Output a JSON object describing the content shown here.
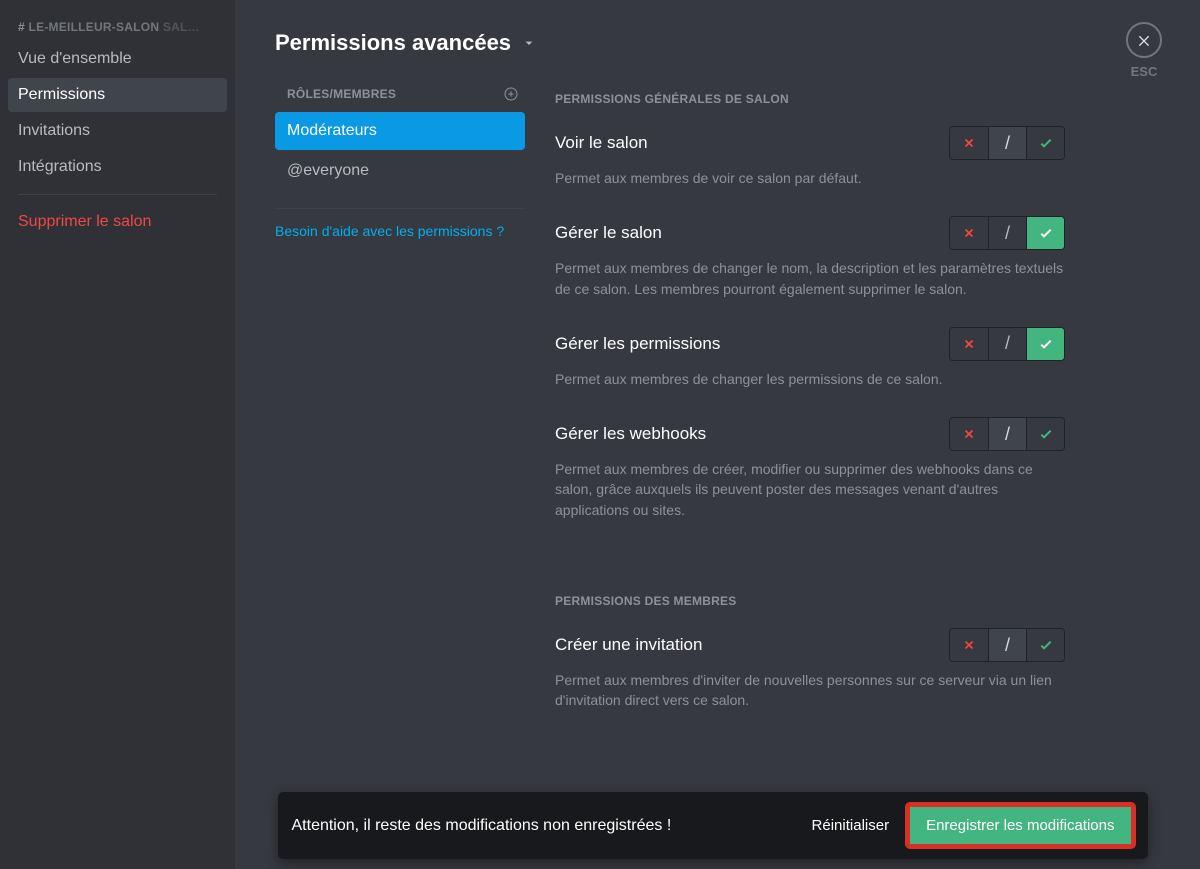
{
  "sidebar": {
    "header_prefix": "# ",
    "header_name": "LE-MEILLEUR-SALON",
    "header_trunc": " SAL…",
    "items": [
      {
        "label": "Vue d'ensemble",
        "active": false
      },
      {
        "label": "Permissions",
        "active": true
      },
      {
        "label": "Invitations",
        "active": false
      },
      {
        "label": "Intégrations",
        "active": false
      }
    ],
    "delete_label": "Supprimer le salon"
  },
  "header": {
    "title": "Permissions avancées",
    "esc": "ESC"
  },
  "roles": {
    "header": "RÔLES/MEMBRES",
    "items": [
      {
        "label": "Modérateurs",
        "active": true
      },
      {
        "label": "@everyone",
        "active": false
      }
    ],
    "help": "Besoin d'aide avec les permissions ?"
  },
  "sections": [
    {
      "header": "PERMISSIONS GÉNÉRALES DE SALON",
      "perms": [
        {
          "title": "Voir le salon",
          "desc": "Permet aux membres de voir ce salon par défaut.",
          "state": "pass"
        },
        {
          "title": "Gérer le salon",
          "desc": "Permet aux membres de changer le nom, la description et les paramètres textuels de ce salon. Les membres pourront également supprimer le salon.",
          "state": "allow"
        },
        {
          "title": "Gérer les permissions",
          "desc": "Permet aux membres de changer les permissions de ce salon.",
          "state": "allow"
        },
        {
          "title": "Gérer les webhooks",
          "desc": "Permet aux membres de créer, modifier ou supprimer des webhooks dans ce salon, grâce auxquels ils peuvent poster des messages venant d'autres applications ou sites.",
          "state": "pass"
        }
      ]
    },
    {
      "header": "PERMISSIONS DES MEMBRES",
      "perms": [
        {
          "title": "Créer une invitation",
          "desc": "Permet aux membres d'inviter de nouvelles personnes sur ce serveur via un lien d'invitation direct vers ce salon.",
          "state": "pass"
        }
      ]
    }
  ],
  "savebar": {
    "message": "Attention, il reste des modifications non enregistrées !",
    "reset": "Réinitialiser",
    "save": "Enregistrer les modifications"
  }
}
